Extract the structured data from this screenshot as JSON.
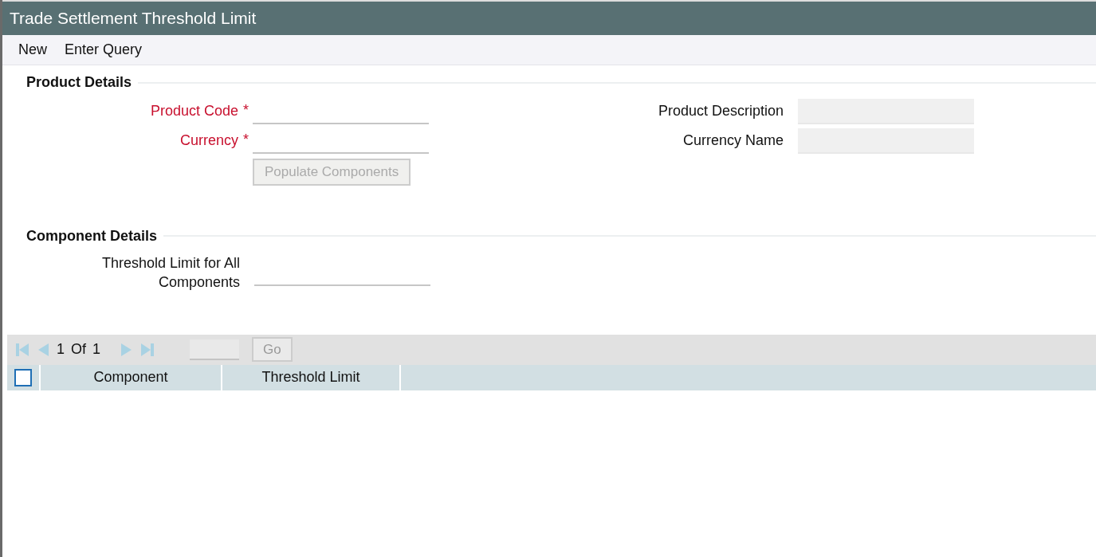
{
  "window": {
    "title": "Trade Settlement Threshold Limit"
  },
  "toolbar": [
    {
      "label": "New"
    },
    {
      "label": "Enter Query"
    }
  ],
  "required_mark": "*",
  "product_details": {
    "title": "Product Details",
    "left_fields": [
      {
        "label": "Product Code",
        "required": true,
        "readonly": false
      },
      {
        "label": "Currency",
        "required": true,
        "readonly": false
      }
    ],
    "right_fields": [
      {
        "label": "Product Description",
        "required": false,
        "readonly": true
      },
      {
        "label": "Currency Name",
        "required": false,
        "readonly": true
      }
    ],
    "button": {
      "label": "Populate Components",
      "disabled": true
    }
  },
  "component_details": {
    "title": "Component Details",
    "fields": [
      {
        "label": "Threshold Limit for All Components",
        "required": false,
        "readonly": false
      }
    ]
  },
  "pager": {
    "current": "1",
    "of": "Of",
    "total": "1",
    "disabled": true,
    "go": {
      "label": "Go",
      "disabled": true
    }
  },
  "table": {
    "select_all": {
      "checked": false
    },
    "columns": [
      "Component",
      "Threshold Limit"
    ]
  }
}
